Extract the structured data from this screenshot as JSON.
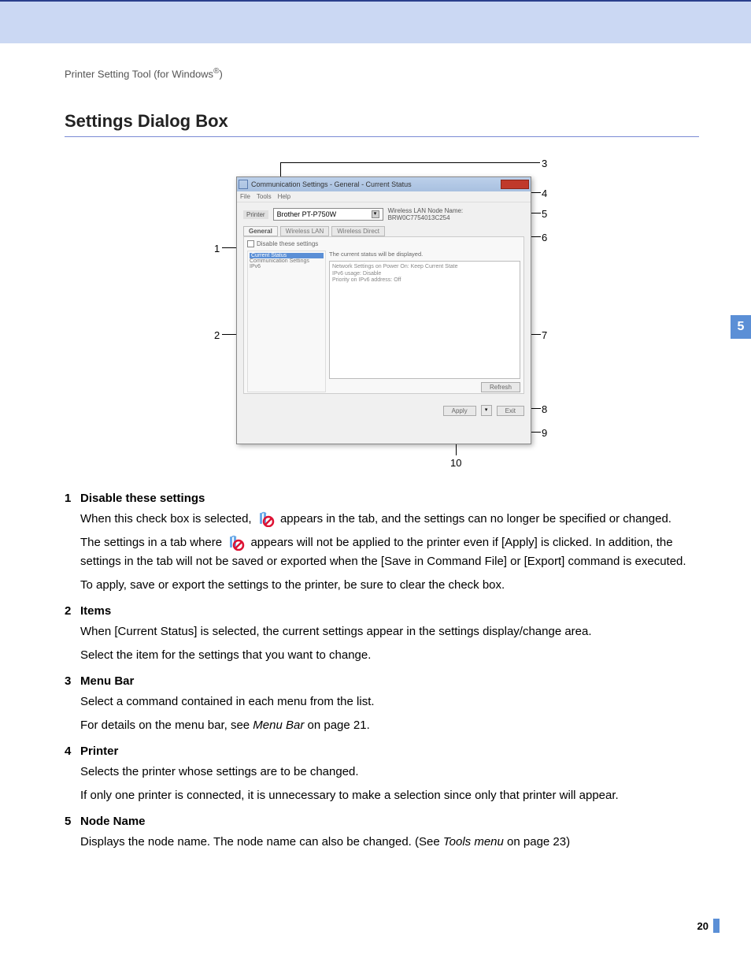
{
  "header": "Printer Setting Tool (for Windows",
  "header_sup": "®",
  "header_end": ")",
  "heading": "Settings Dialog Box",
  "side_chapter": "5",
  "page_number": "20",
  "callouts": {
    "c1": "1",
    "c2": "2",
    "c3": "3",
    "c4": "4",
    "c5": "5",
    "c6": "6",
    "c7": "7",
    "c8": "8",
    "c9": "9",
    "c10": "10"
  },
  "dialog": {
    "title": "Communication Settings - General - Current Status",
    "menu": {
      "file": "File",
      "tools": "Tools",
      "help": "Help"
    },
    "printer_label": "Printer",
    "printer_value": "Brother PT-P750W",
    "node_label": "Wireless LAN Node Name: BRW0C7754013C254",
    "tabs": {
      "general": "General",
      "wlan": "Wireless LAN",
      "wdirect": "Wireless Direct"
    },
    "checkbox": "Disable these settings",
    "items": {
      "current": "Current Status",
      "comm": "Communication Settings",
      "ipv6": "IPv6"
    },
    "status_label": "The current status will be displayed.",
    "status_body": "Network Settings on Power On: Keep Current State\nIPv6 usage: Disable\nPriority on IPv6 address: Off",
    "refresh": "Refresh",
    "apply": "Apply",
    "exit": "Exit"
  },
  "items": {
    "n1": "1",
    "t1": "Disable these settings",
    "p1a_1": "When this check box is selected, ",
    "p1a_2": " appears in the tab, and the settings can no longer be specified or changed.",
    "p1b_1": "The settings in a tab where ",
    "p1b_2": " appears will not be applied to the printer even if [Apply] is clicked. In addition, the settings in the tab will not be saved or exported when the [Save in Command File] or [Export] command is executed.",
    "p1c": "To apply, save or export the settings to the printer, be sure to clear the check box.",
    "n2": "2",
    "t2": "Items",
    "p2a": "When [Current Status] is selected, the current settings appear in the settings display/change area.",
    "p2b": "Select the item for the settings that you want to change.",
    "n3": "3",
    "t3": "Menu Bar",
    "p3a": "Select a command contained in each menu from the list.",
    "p3b_1": "For details on the menu bar, see ",
    "p3b_i": "Menu Bar",
    "p3b_2": " on page 21.",
    "n4": "4",
    "t4": "Printer",
    "p4a": "Selects the printer whose settings are to be changed.",
    "p4b": "If only one printer is connected, it is unnecessary to make a selection since only that printer will appear.",
    "n5": "5",
    "t5": "Node Name",
    "p5a_1": "Displays the node name. The node name can also be changed. (See ",
    "p5a_i": "Tools menu",
    "p5a_2": " on page 23)"
  }
}
